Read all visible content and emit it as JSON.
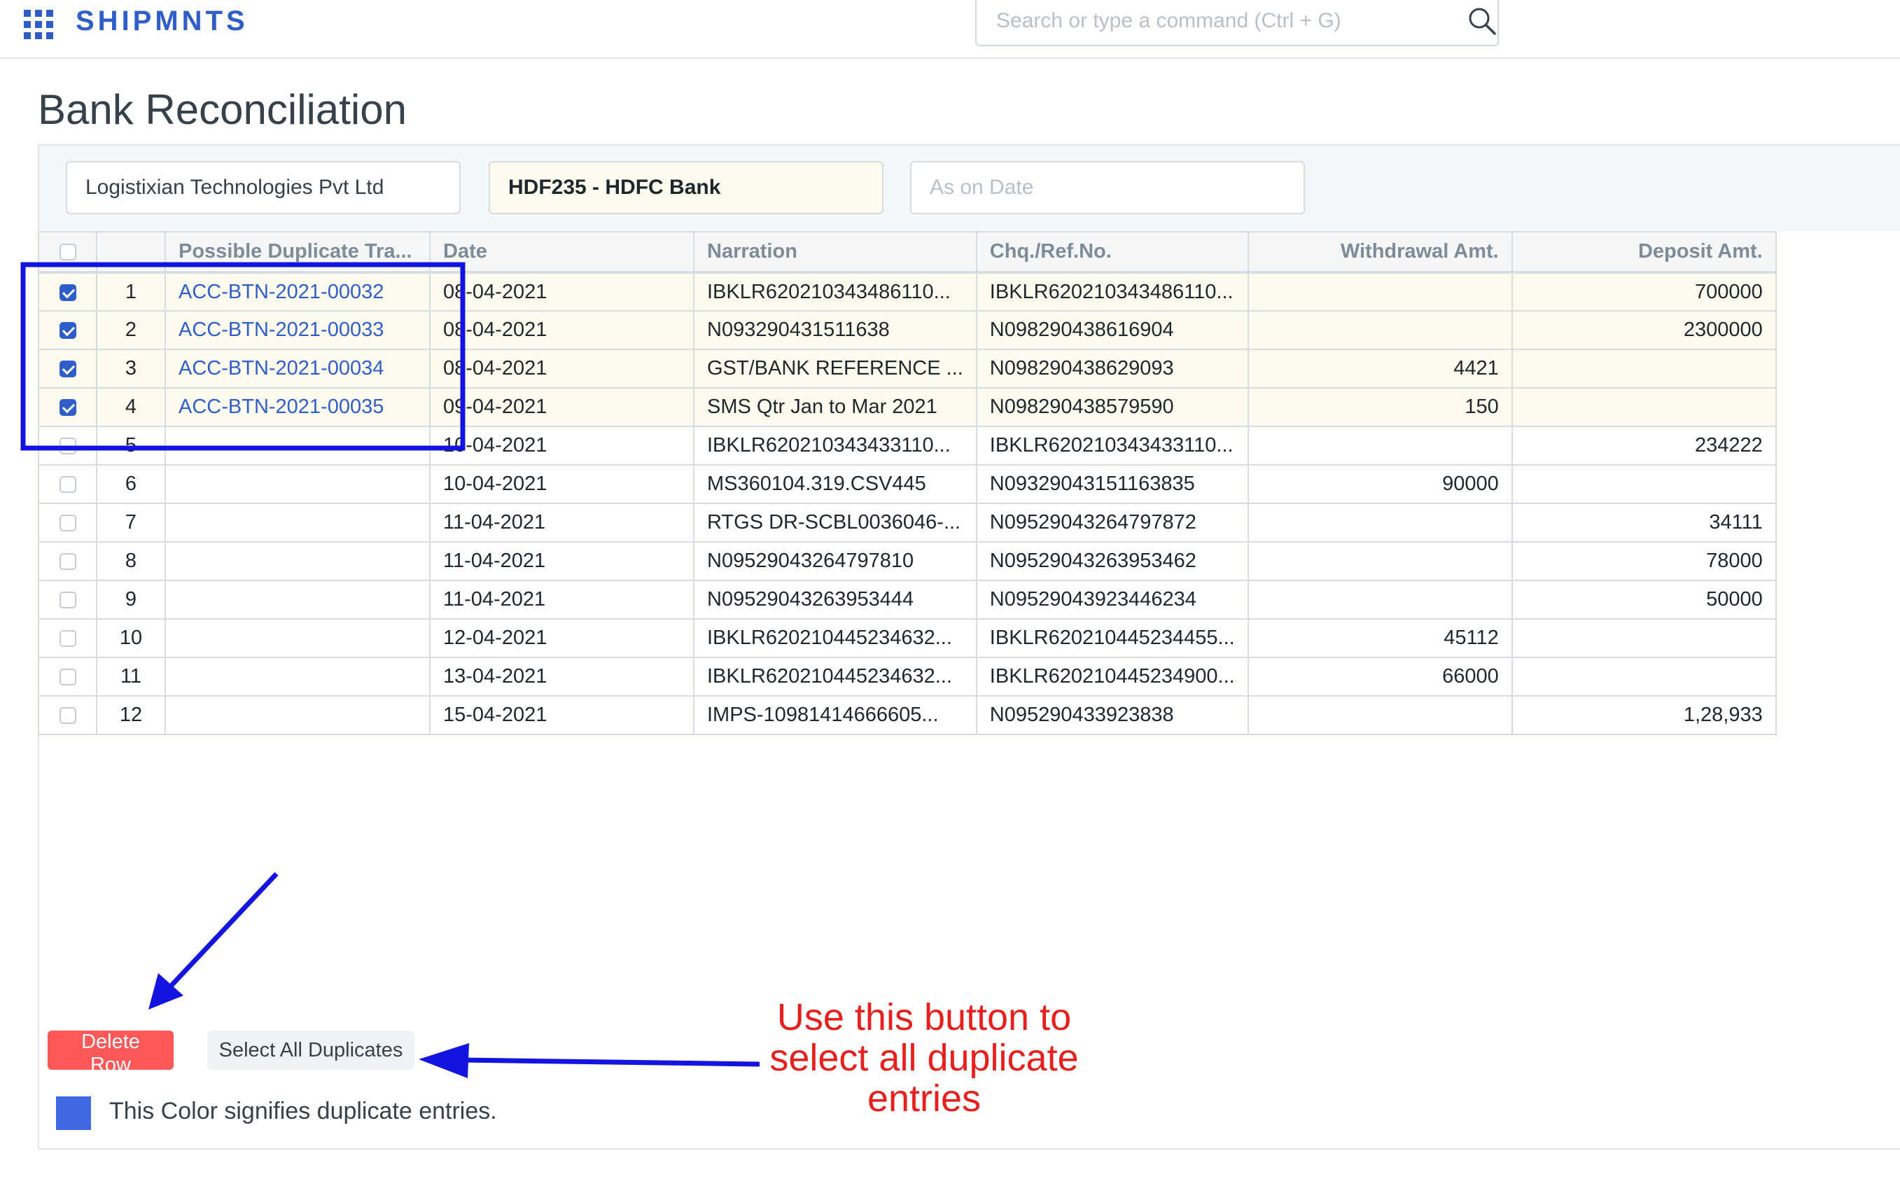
{
  "navbar": {
    "brand": "SHIPMNTS",
    "search_placeholder": "Search or type a command (Ctrl + G)"
  },
  "page": {
    "title": "Bank Reconciliation"
  },
  "filters": {
    "company": "Logistixian Technologies Pvt Ltd",
    "bank_account": "HDF235 - HDFC Bank",
    "date_placeholder": "As on Date"
  },
  "table": {
    "headers": [
      "Possible Duplicate Tra...",
      "Date",
      "Narration",
      "Chq./Ref.No.",
      "Withdrawal Amt.",
      "Deposit Amt."
    ],
    "rows": [
      {
        "idx": "1",
        "checked": true,
        "dup": "ACC-BTN-2021-00032",
        "date": "08-04-2021",
        "narration": "IBKLR620210343486110...",
        "ref": "IBKLR620210343486110...",
        "withdrawal": "",
        "deposit": "700000"
      },
      {
        "idx": "2",
        "checked": true,
        "dup": "ACC-BTN-2021-00033",
        "date": "08-04-2021",
        "narration": "N093290431511638",
        "ref": "N098290438616904",
        "withdrawal": "",
        "deposit": "2300000"
      },
      {
        "idx": "3",
        "checked": true,
        "dup": "ACC-BTN-2021-00034",
        "date": "08-04-2021",
        "narration": "GST/BANK REFERENCE ...",
        "ref": "N098290438629093",
        "withdrawal": "4421",
        "deposit": ""
      },
      {
        "idx": "4",
        "checked": true,
        "dup": "ACC-BTN-2021-00035",
        "date": "09-04-2021",
        "narration": "SMS Qtr Jan to Mar 2021",
        "ref": "N098290438579590",
        "withdrawal": "150",
        "deposit": ""
      },
      {
        "idx": "5",
        "checked": false,
        "dup": "",
        "date": "10-04-2021",
        "narration": "IBKLR620210343433110...",
        "ref": "IBKLR620210343433110...",
        "withdrawal": "",
        "deposit": "234222"
      },
      {
        "idx": "6",
        "checked": false,
        "dup": "",
        "date": "10-04-2021",
        "narration": "MS360104.319.CSV445",
        "ref": "N09329043151163835",
        "withdrawal": "90000",
        "deposit": ""
      },
      {
        "idx": "7",
        "checked": false,
        "dup": "",
        "date": "11-04-2021",
        "narration": "RTGS DR-SCBL0036046-...",
        "ref": "N095290432647978​72",
        "withdrawal": "",
        "deposit": "34111"
      },
      {
        "idx": "8",
        "checked": false,
        "dup": "",
        "date": "11-04-2021",
        "narration": "N09529043264797810",
        "ref": "N09529043263953462",
        "withdrawal": "",
        "deposit": "78000"
      },
      {
        "idx": "9",
        "checked": false,
        "dup": "",
        "date": "11-04-2021",
        "narration": "N09529043263953444",
        "ref": "N09529043923446234",
        "withdrawal": "",
        "deposit": "50000"
      },
      {
        "idx": "10",
        "checked": false,
        "dup": "",
        "date": "12-04-2021",
        "narration": "IBKLR620210445234632...",
        "ref": "IBKLR620210445234455...",
        "withdrawal": "45112",
        "deposit": ""
      },
      {
        "idx": "11",
        "checked": false,
        "dup": "",
        "date": "13-04-2021",
        "narration": "IBKLR620210445234632...",
        "ref": "IBKLR620210445234900...",
        "withdrawal": "66000",
        "deposit": ""
      },
      {
        "idx": "12",
        "checked": false,
        "dup": "",
        "date": "15-04-2021",
        "narration": "IMPS-10981414666605...",
        "ref": "N095290433923838",
        "withdrawal": "",
        "deposit": "1,28,933"
      }
    ]
  },
  "actions": {
    "delete_label": "Delete Row",
    "select_all_label": "Select All Duplicates"
  },
  "legend": {
    "text": "This Color signifies duplicate entries.",
    "color": "#4169e1"
  },
  "annotations": {
    "callout_lines": [
      "Use this button to",
      "select all duplicate",
      "entries"
    ],
    "highlight_color": "#1414e0",
    "callout_color": "#e8201d"
  },
  "colors": {
    "brand": "#2f5ec9",
    "duplicate_row_bg": "#fdfbee",
    "delete_button": "#ff5858"
  }
}
